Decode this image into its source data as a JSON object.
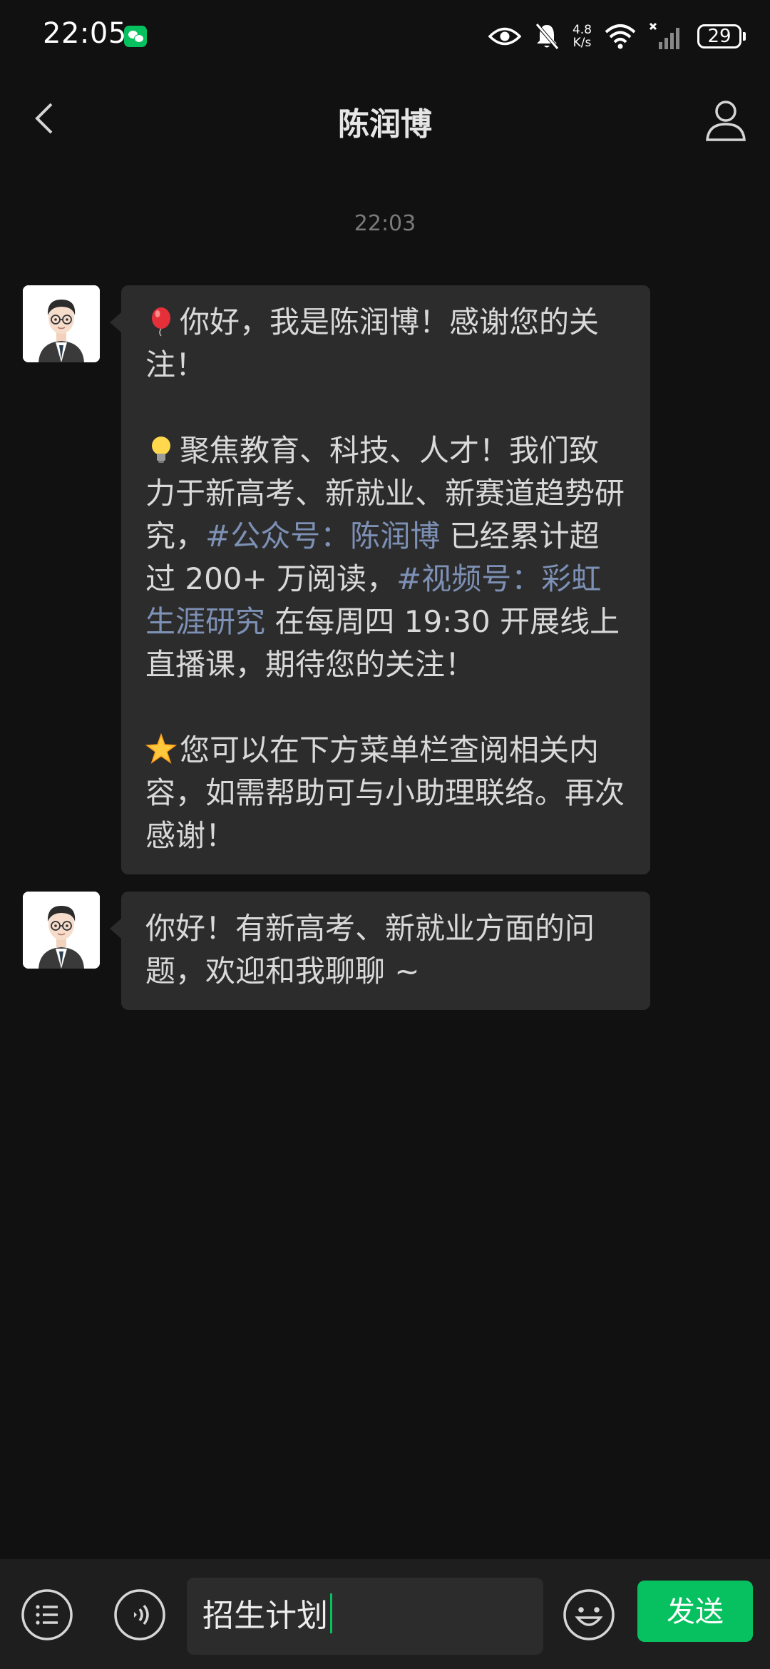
{
  "status_bar": {
    "time": "22:05",
    "net_speed_value": "4.8",
    "net_speed_unit": "K/s",
    "battery": "29"
  },
  "nav": {
    "title": "陈润博",
    "icons": {
      "back": "chevron-left-icon",
      "profile": "person-icon"
    }
  },
  "chat": {
    "timestamp": "22:03",
    "messages": [
      {
        "sender": "陈润博",
        "p1_text": "你好，我是陈润博！感谢您的关注！",
        "p1_emoji": "balloon",
        "p2_emoji": "light-bulb",
        "p2_text_a": "聚焦教育、科技、人才！我们致力于新高考、新就业、新赛道趋势研究，",
        "p2_link1": "#公众号：陈润博",
        "p2_text_b": " 已经累计超过 200+ 万阅读，",
        "p2_link2": "#视频号：彩虹生涯研究",
        "p2_text_c": " 在每周四 19:30 开展线上直播课，期待您的关注！",
        "p3_emoji": "glowing-star",
        "p3_text": "您可以在下方菜单栏查阅相关内容，如需帮助可与小助理联络。再次感谢！"
      },
      {
        "sender": "陈润博",
        "text": "你好！有新高考、新就业方面的问题，欢迎和我聊聊 ~"
      }
    ]
  },
  "input_bar": {
    "value": "招生计划",
    "send_label": "发送",
    "icons": {
      "menu": "list-menu-icon",
      "voice": "voice-icon",
      "emoji": "smiley-icon"
    }
  },
  "colors": {
    "background": "#111111",
    "bubble": "#2c2c2c",
    "accent_green": "#07c160",
    "link": "#7d90b5"
  }
}
